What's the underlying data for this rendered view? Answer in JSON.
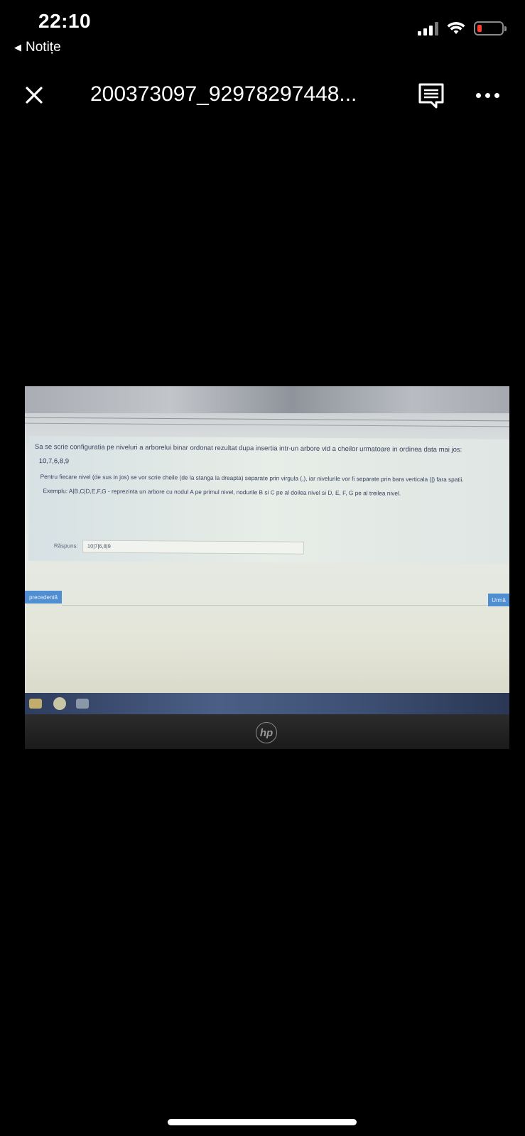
{
  "status_bar": {
    "time": "22:10",
    "back_label": "Notițe",
    "battery_color": "#ff3b30"
  },
  "toolbar": {
    "title": "200373097_92978297448...",
    "icons": [
      "close-icon",
      "comment-icon",
      "more-icon"
    ]
  },
  "photo": {
    "question": {
      "line1": "Sa se scrie configuratia pe niveluri a arborelui binar ordonat rezultat dupa insertia intr-un arbore vid a cheilor urmatoare in ordinea data mai jos:",
      "keys": "10,7,6,8,9",
      "instruction": "Pentru fiecare nivel (de sus in jos) se vor scrie cheile (de la stanga la dreapta) separate prin virgula (,), iar nivelurile vor fi separate prin bara verticala (|) fara spatii.",
      "example": "Exemplu: A|B,C|D,E,F,G - reprezinta un arbore cu nodul A pe primul nivel, nodurile B si C pe al doilea nivel si D, E, F, G pe al treilea nivel."
    },
    "answer": {
      "label": "Răspuns:",
      "value": "10|7|6,8|9"
    },
    "nav": {
      "prev_label": "precedentă",
      "next_label": "Urmă"
    },
    "laptop_logo": "hp"
  }
}
